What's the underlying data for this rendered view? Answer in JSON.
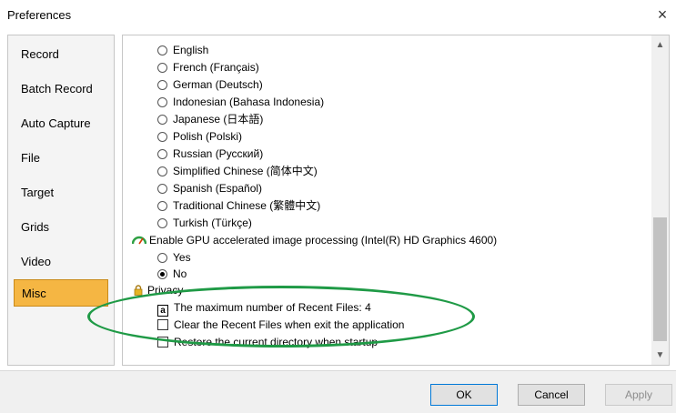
{
  "window": {
    "title": "Preferences",
    "close_label": "×"
  },
  "sidebar": {
    "items": [
      {
        "label": "Record",
        "active": false
      },
      {
        "label": "Batch Record",
        "active": false
      },
      {
        "label": "Auto Capture",
        "active": false
      },
      {
        "label": "File",
        "active": false
      },
      {
        "label": "Target",
        "active": false
      },
      {
        "label": "Grids",
        "active": false
      },
      {
        "label": "Video",
        "active": false
      },
      {
        "label": "Misc",
        "active": true
      }
    ]
  },
  "languages": [
    {
      "label": "English",
      "selected": false
    },
    {
      "label": "French (Français)",
      "selected": false
    },
    {
      "label": "German (Deutsch)",
      "selected": false
    },
    {
      "label": "Indonesian (Bahasa Indonesia)",
      "selected": false
    },
    {
      "label": "Japanese (日本語)",
      "selected": false
    },
    {
      "label": "Polish (Polski)",
      "selected": false
    },
    {
      "label": "Russian (Русский)",
      "selected": false
    },
    {
      "label": "Simplified Chinese (简体中文)",
      "selected": false
    },
    {
      "label": "Spanish (Español)",
      "selected": false
    },
    {
      "label": "Traditional Chinese (繁體中文)",
      "selected": false
    },
    {
      "label": "Turkish (Türkçe)",
      "selected": false
    }
  ],
  "gpu": {
    "label": "Enable GPU accelerated image processing (Intel(R) HD Graphics 4600)",
    "options": [
      {
        "label": "Yes",
        "selected": false
      },
      {
        "label": "No",
        "selected": true
      }
    ]
  },
  "privacy": {
    "label": "Privacy",
    "max_recent": "The maximum number of Recent Files: 4",
    "clear_recent": {
      "label": "Clear the Recent Files when exit the application",
      "checked": false
    },
    "restore_dir": {
      "label": "Restore the current directory when startup",
      "checked": false
    }
  },
  "buttons": {
    "ok": "OK",
    "cancel": "Cancel",
    "apply": "Apply"
  },
  "colors": {
    "active_tab": "#f5b643",
    "annotation": "#1f9a46"
  }
}
